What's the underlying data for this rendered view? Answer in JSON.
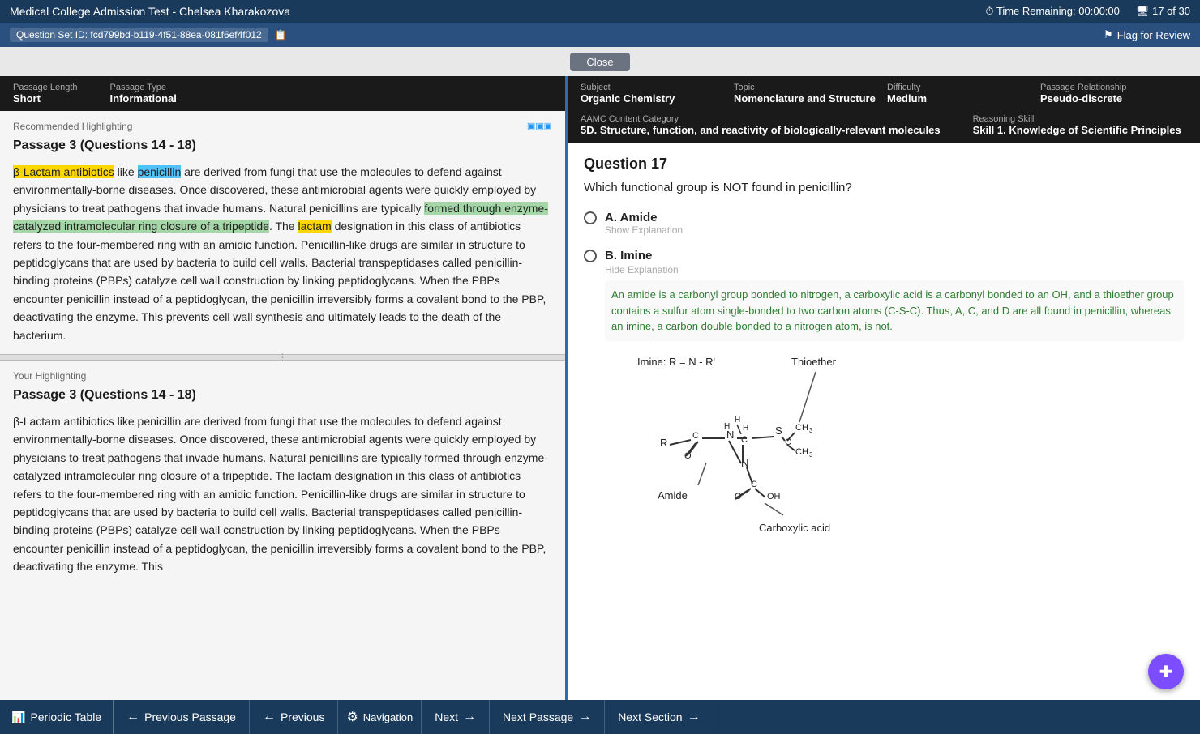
{
  "header": {
    "title": "Medical College Admission Test - Chelsea Kharakozova",
    "time_remaining_label": "Time Remaining:",
    "time_remaining_value": "00:00:00",
    "question_progress": "17 of 30",
    "question_set_id": "Question Set ID: fcd799bd-b119-4f51-88ea-081f6ef4f012",
    "flag_review": "Flag for Review"
  },
  "close_button": "Close",
  "left_panel": {
    "passage_length_label": "Passage Length",
    "passage_length_value": "Short",
    "passage_type_label": "Passage Type",
    "passage_type_value": "Informational",
    "recommended_highlighting_label": "Recommended Highlighting",
    "passage_title": "Passage 3 (Questions 14 - 18)",
    "passage_body": "β-Lactam antibiotics like penicillin are derived from fungi that use the molecules to defend against environmentally-borne diseases. Once discovered, these antimicrobial agents were quickly employed by physicians to treat pathogens that invade humans. Natural penicillins are typically formed through enzyme-catalyzed intramolecular ring closure of a tripeptide. The lactam designation in this class of antibiotics refers to the four-membered ring with an amidic function. Penicillin-like drugs are similar in structure to peptidoglycans that are used by bacteria to build cell walls. Bacterial transpeptidases called penicillin-binding proteins (PBPs) catalyze cell wall construction by linking peptidoglycans. When the PBPs encounter penicillin instead of a peptidoglycan, the penicillin irreversibly forms a covalent bond to the PBP, deactivating the enzyme. This prevents cell wall synthesis and ultimately leads to the death of the bacterium.",
    "your_highlighting_label": "Your Highlighting",
    "your_passage_title": "Passage 3 (Questions 14 - 18)",
    "your_passage_body": "β-Lactam antibiotics like penicillin are derived from fungi that use the molecules to defend against environmentally-borne diseases. Once discovered, these antimicrobial agents were quickly employed by physicians to treat pathogens that invade humans. Natural penicillins are typically formed through enzyme-catalyzed intramolecular ring closure of a tripeptide. The lactam designation in this class of antibiotics refers to the four-membered ring with an amidic function. Penicillin-like drugs are similar in structure to peptidoglycans that are used by bacteria to build cell walls. Bacterial transpeptidases called penicillin-binding proteins (PBPs) catalyze cell wall construction by linking peptidoglycans. When the PBPs encounter penicillin instead of a peptidoglycan, the penicillin irreversibly forms a covalent bond to the PBP, deactivating the enzyme. This"
  },
  "right_panel": {
    "subject_label": "Subject",
    "subject_value": "Organic Chemistry",
    "topic_label": "Topic",
    "topic_value": "Nomenclature and Structure",
    "difficulty_label": "Difficulty",
    "difficulty_value": "Medium",
    "passage_relationship_label": "Passage Relationship",
    "passage_relationship_value": "Pseudo-discrete",
    "aamc_label": "AAMC Content Category",
    "aamc_value": "5D. Structure, function, and reactivity of biologically-relevant molecules",
    "reasoning_label": "Reasoning Skill",
    "reasoning_value": "Skill 1. Knowledge of Scientific Principles",
    "question_number": "Question 17",
    "question_text": "Which functional group is NOT found in penicillin?",
    "answers": [
      {
        "letter": "A.",
        "text": "Amide",
        "has_show_explanation": true,
        "show_explanation_text": "Show Explanation",
        "expanded": false
      },
      {
        "letter": "B.",
        "text": "Imine",
        "has_hide_explanation": true,
        "hide_explanation_text": "Hide Explanation",
        "expanded": true,
        "explanation": "An amide is a carbonyl group bonded to nitrogen, a carboxylic acid is a carbonyl bonded to an OH, and a thioether group contains a sulfur atom single-bonded to two carbon atoms (C-S-C). Thus, A, C, and D are all found in penicillin, whereas an imine, a carbon double bonded to a nitrogen atom, is not."
      }
    ],
    "imine_label": "Imine: R = N - R'",
    "thioether_label": "Thioether",
    "amide_label": "Amide",
    "carboxylic_acid_label": "Carboxylic acid"
  },
  "bottom_nav": {
    "periodic_table": "Periodic Table",
    "previous_passage": "Previous Passage",
    "previous": "Previous",
    "navigation": "Navigation",
    "next": "Next",
    "next_passage": "Next Passage",
    "next_section": "Next Section"
  }
}
